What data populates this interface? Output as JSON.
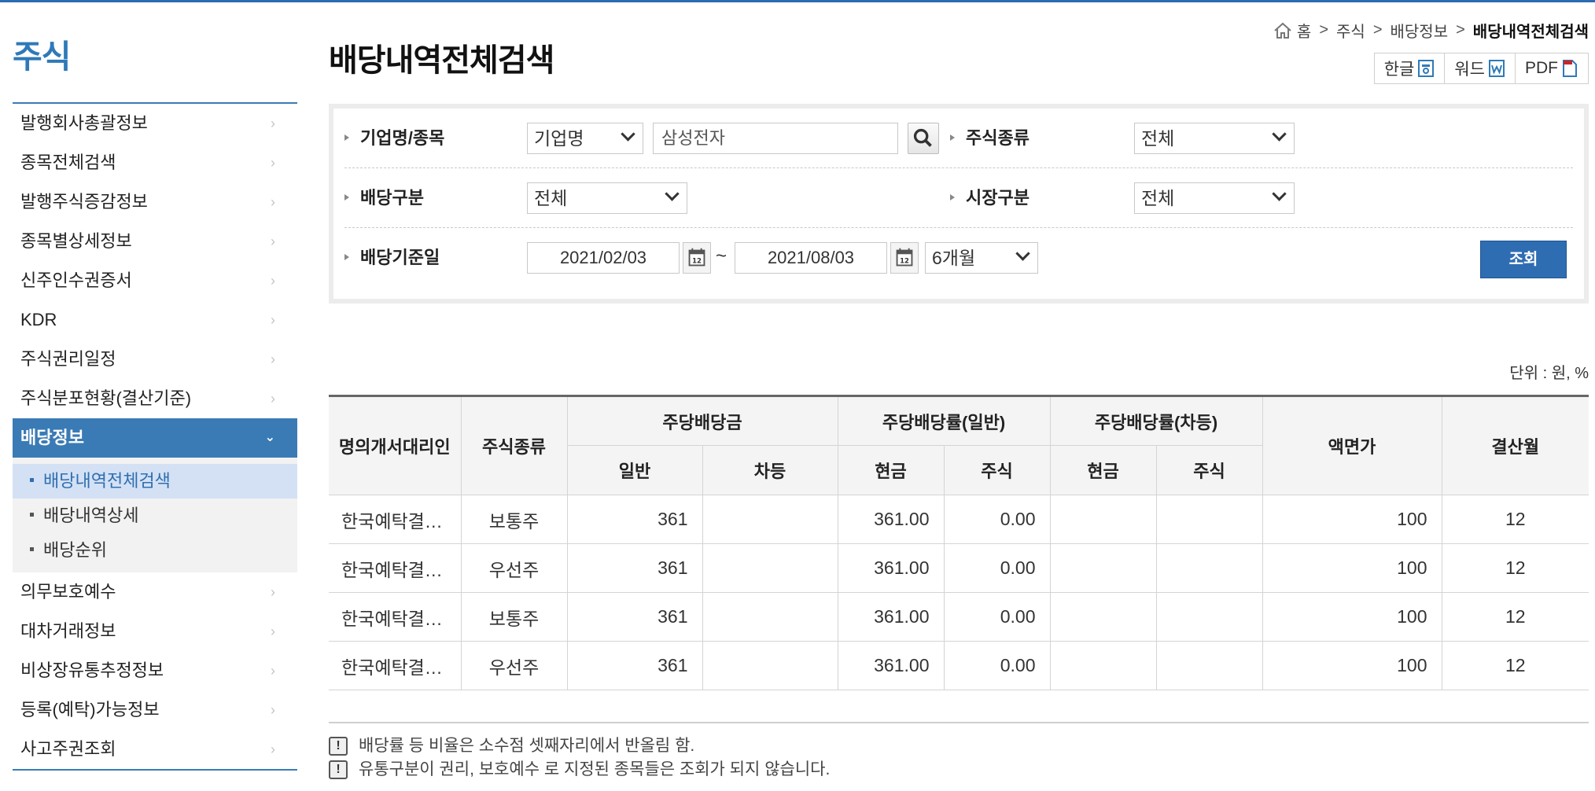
{
  "sidebar": {
    "title": "주식",
    "items": [
      {
        "label": "발행회사총괄정보"
      },
      {
        "label": "종목전체검색"
      },
      {
        "label": "발행주식증감정보"
      },
      {
        "label": "종목별상세정보"
      },
      {
        "label": "신주인수권증서"
      },
      {
        "label": "KDR"
      },
      {
        "label": "주식권리일정"
      },
      {
        "label": "주식분포현황(결산기준)"
      },
      {
        "label": "배당정보"
      },
      {
        "label": "의무보호예수"
      },
      {
        "label": "대차거래정보"
      },
      {
        "label": "비상장유통추정정보"
      },
      {
        "label": "등록(예탁)가능정보"
      },
      {
        "label": "사고주권조회"
      }
    ],
    "sub_items": [
      {
        "label": "배당내역전체검색"
      },
      {
        "label": "배당내역상세"
      },
      {
        "label": "배당순위"
      }
    ],
    "chevron": "›",
    "chevron_open": "⌄"
  },
  "header": {
    "title": "배당내역전체검색",
    "breadcrumb": [
      "홈",
      "주식",
      "배당정보",
      "배당내역전체검색"
    ],
    "breadcrumb_sep": ">",
    "export": [
      {
        "label": "한글",
        "icon": "hwp-icon"
      },
      {
        "label": "워드",
        "icon": "word-icon"
      },
      {
        "label": "PDF",
        "icon": "pdf-icon"
      }
    ]
  },
  "search": {
    "company_label": "기업명/종목",
    "company_type": "기업명",
    "company_value": "삼성전자",
    "stock_type_label": "주식종류",
    "stock_type_value": "전체",
    "dividend_type_label": "배당구분",
    "dividend_type_value": "전체",
    "market_label": "시장구분",
    "market_value": "전체",
    "date_label": "배당기준일",
    "date_from": "2021/02/03",
    "date_to": "2021/08/03",
    "tilde": "~",
    "period": "6개월",
    "query_button": "조회"
  },
  "unit": "단위 : 원, %",
  "table": {
    "headers": {
      "agent": "명의개서대리인",
      "stock_type": "주식종류",
      "dps": "주당배당금",
      "rate_general": "주당배당률(일반)",
      "rate_diff": "주당배당률(차등)",
      "par": "액면가",
      "settle_month": "결산월",
      "general": "일반",
      "diff": "차등",
      "cash1": "현금",
      "stock1": "주식",
      "cash2": "현금",
      "stock2": "주식"
    },
    "rows": [
      {
        "agent": "한국예탁결…",
        "type": "보통주",
        "general": "361",
        "diff": "",
        "cash": "361.00",
        "stock": "0.00",
        "cash2": "",
        "stock2": "",
        "par": "100",
        "month": "12"
      },
      {
        "agent": "한국예탁결…",
        "type": "우선주",
        "general": "361",
        "diff": "",
        "cash": "361.00",
        "stock": "0.00",
        "cash2": "",
        "stock2": "",
        "par": "100",
        "month": "12"
      },
      {
        "agent": "한국예탁결…",
        "type": "보통주",
        "general": "361",
        "diff": "",
        "cash": "361.00",
        "stock": "0.00",
        "cash2": "",
        "stock2": "",
        "par": "100",
        "month": "12"
      },
      {
        "agent": "한국예탁결…",
        "type": "우선주",
        "general": "361",
        "diff": "",
        "cash": "361.00",
        "stock": "0.00",
        "cash2": "",
        "stock2": "",
        "par": "100",
        "month": "12"
      }
    ]
  },
  "notes": [
    "배당률 등 비율은 소수점 셋째자리에서 반올림 함.",
    "유통구분이 권리, 보호예수 로 지정된 종목들은 조회가 되지 않습니다."
  ],
  "colors": {
    "accent": "#3b7bb5",
    "title_blue": "#2f79b8",
    "button_blue": "#2f6db3",
    "sub_highlight": "#d4e1f5"
  }
}
